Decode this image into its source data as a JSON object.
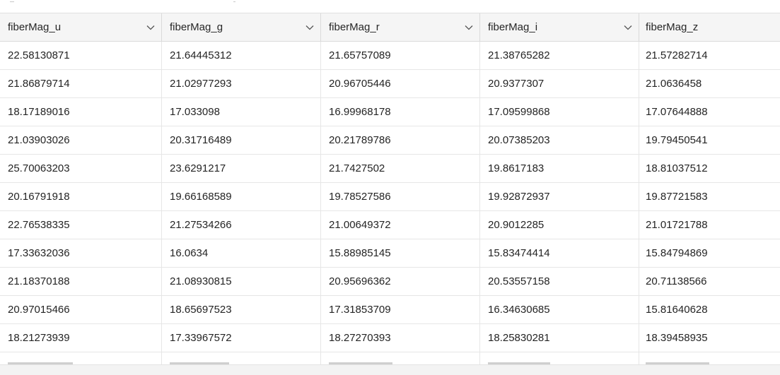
{
  "columns": [
    "fiberMag_u",
    "fiberMag_g",
    "fiberMag_r",
    "fiberMag_i",
    "fiberMag_z"
  ],
  "rows": [
    [
      "22.58130871",
      "21.64445312",
      "21.65757089",
      "21.38765282",
      "21.57282714"
    ],
    [
      "21.86879714",
      "21.02977293",
      "20.96705446",
      "20.9377307",
      "21.0636458"
    ],
    [
      "18.17189016",
      "17.033098",
      "16.99968178",
      "17.09599868",
      "17.07644888"
    ],
    [
      "21.03903026",
      "20.31716489",
      "20.21789786",
      "20.07385203",
      "19.79450541"
    ],
    [
      "25.70063203",
      "23.6291217",
      "21.7427502",
      "19.8617183",
      "18.81037512"
    ],
    [
      "20.16791918",
      "19.66168589",
      "19.78527586",
      "19.92872937",
      "19.87721583"
    ],
    [
      "22.76538335",
      "21.27534266",
      "21.00649372",
      "20.9012285",
      "21.01721788"
    ],
    [
      "17.33632036",
      "16.0634",
      "15.88985145",
      "15.83474414",
      "15.84794869"
    ],
    [
      "21.18370188",
      "21.08930815",
      "20.95696362",
      "20.53557158",
      "20.71138566"
    ],
    [
      "20.97015466",
      "18.65697523",
      "17.31853709",
      "16.34630685",
      "15.81640628"
    ],
    [
      "18.21273939",
      "17.33967572",
      "18.27270393",
      "18.25830281",
      "18.39458935"
    ]
  ],
  "icons": {
    "column_menu": "chevron-down-icon"
  }
}
